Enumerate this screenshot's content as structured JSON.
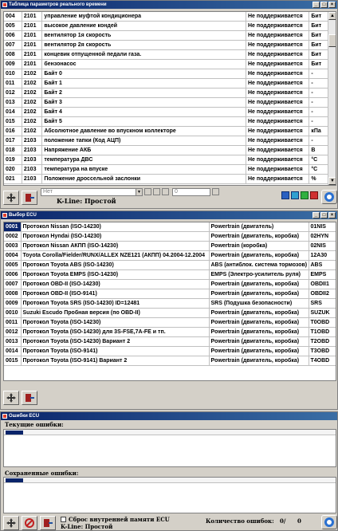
{
  "realtime": {
    "title": "Таблица параметров реального времени",
    "rows": [
      [
        "004",
        "2101",
        "управление муфтой кондиционера",
        "Не поддерживается",
        "Бит"
      ],
      [
        "005",
        "2101",
        "высокое давление кондей",
        "Не поддерживается",
        "Бит"
      ],
      [
        "006",
        "2101",
        "вентилятор 1я скорость",
        "Не поддерживается",
        "Бит"
      ],
      [
        "007",
        "2101",
        "вентилятор 2я скорость",
        "Не поддерживается",
        "Бит"
      ],
      [
        "008",
        "2101",
        "концевик отпущенной педали газа.",
        "Не поддерживается",
        "Бит"
      ],
      [
        "009",
        "2101",
        "бензонасос",
        "Не поддерживается",
        "Бит"
      ],
      [
        "010",
        "2102",
        "Байт 0",
        "Не поддерживается",
        "-"
      ],
      [
        "011",
        "2102",
        "Байт 1",
        "Не поддерживается",
        "-"
      ],
      [
        "012",
        "2102",
        "Байт 2",
        "Не поддерживается",
        "-"
      ],
      [
        "013",
        "2102",
        "Байт 3",
        "Не поддерживается",
        "-"
      ],
      [
        "014",
        "2102",
        "Байт 4",
        "Не поддерживается",
        "-"
      ],
      [
        "015",
        "2102",
        "Байт 5",
        "Не поддерживается",
        "-"
      ],
      [
        "016",
        "2102",
        "Абсолютное давление во впускном коллекторе",
        "Не поддерживается",
        "кПа"
      ],
      [
        "017",
        "2103",
        "положение тапки (Код АЦП)",
        "Не поддерживается",
        "-"
      ],
      [
        "018",
        "2103",
        "Напряжение АКБ",
        "Не поддерживается",
        "В"
      ],
      [
        "019",
        "2103",
        "температура ДВС",
        "Не поддерживается",
        "°С"
      ],
      [
        "020",
        "2103",
        "температура на впуске",
        "Не поддерживается",
        "°С"
      ],
      [
        "021",
        "2103",
        "Положение дроссельной заслонки",
        "Не поддерживается",
        "%"
      ]
    ],
    "combo_value": "Нет",
    "number_value": "0",
    "kline": "K-Line: Простой"
  },
  "ecu": {
    "title": "Выбор ECU",
    "rows": [
      [
        "0001",
        "Протокол Nissan (ISO-14230)",
        "Powertrain (двигатель)",
        "01NIS"
      ],
      [
        "0002",
        "Протокол Hyndai (ISO-14230)",
        "Powertrain (двигатель, коробка)",
        "02HYN"
      ],
      [
        "0003",
        "Протокол Nissan АКПП (ISO-14230)",
        "Powertrain (коробка)",
        "02NIS"
      ],
      [
        "0004",
        "Toyota Corolla/Fielder/RUNX/ALLEX NZE121 (АКПП) 04.2004-12.2004",
        "Powertrain (двигатель, коробка)",
        "12A30"
      ],
      [
        "0005",
        "Протокол Toyota ABS (ISO-14230)",
        "ABS (антиблок. система тормозов)",
        "ABS"
      ],
      [
        "0006",
        "Протокол Toyota EMPS (ISO-14230)",
        "EMPS (Электро-усилитель руля)",
        "EMPS"
      ],
      [
        "0007",
        "Протокол OBD-II (ISO-14230)",
        "Powertrain (двигатель, коробка)",
        "OBDII1"
      ],
      [
        "0008",
        "Протокол OBD-II (ISO-9141)",
        "Powertrain (двигатель, коробка)",
        "OBDII2"
      ],
      [
        "0009",
        "Протокол Toyota SRS (ISO-14230) ID=12481",
        "SRS (Подушка безопасности)",
        "SRS"
      ],
      [
        "0010",
        "Suzuki Escudo Пробная версия (по OBD-II)",
        "Powertrain (двигатель, коробка)",
        "SUZUK"
      ],
      [
        "0011",
        "Протокол Toyota (ISO-14230)",
        "Powertrain (двигатель, коробка)",
        "T0OBD"
      ],
      [
        "0012",
        "Протокол Toyota (ISO-14230) для 3S-FSE,7A-FE и тп.",
        "Powertrain (двигатель, коробка)",
        "T1OBD"
      ],
      [
        "0013",
        "Протокол Toyota (ISO-14230) Вариант 2",
        "Powertrain (двигатель, коробка)",
        "T2OBD"
      ],
      [
        "0014",
        "Протокол Toyota (ISO-9141)",
        "Powertrain (двигатель, коробка)",
        "T3OBD"
      ],
      [
        "0015",
        "Протокол Toyota (ISO-9141) Вариант 2",
        "Powertrain (двигатель, коробка)",
        "T4OBD"
      ]
    ]
  },
  "errors": {
    "title": "Ошибки ECU",
    "current_label": "Текущие ошибки:",
    "saved_label": "Сохраненные ошибки:",
    "reset_label": "Сброс внутренней памяти ECU",
    "count_label": "Количество ошибок:",
    "count_a": "0/",
    "count_b": "0",
    "kline": "K-Line: Простой"
  },
  "colors": {
    "title_start": "#0a246a",
    "title_end": "#3a6ea5",
    "selected": "#0a246a"
  }
}
